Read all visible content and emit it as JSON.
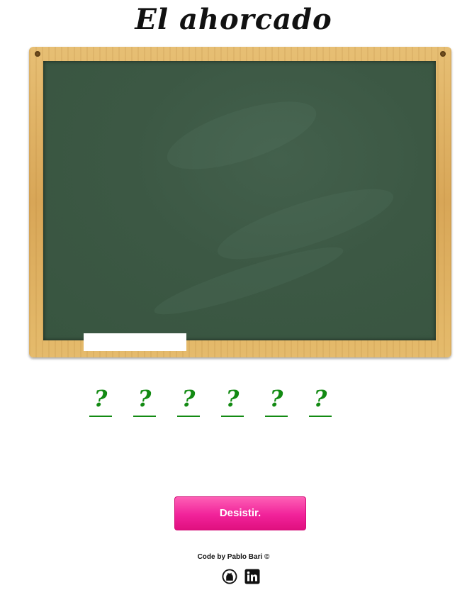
{
  "title": "El ahorcado",
  "letters": [
    "?",
    "?",
    "?",
    "?",
    "?",
    "?"
  ],
  "give_up_label": "Desistir.",
  "credit": "Code by Pablo Bari ©",
  "social": {
    "github_icon": "github-icon",
    "linkedin_icon": "linkedin-icon"
  },
  "colors": {
    "letter": "#128a12",
    "button": "#f1229a",
    "slate": "#3c5844",
    "frame": "#d8a657"
  }
}
